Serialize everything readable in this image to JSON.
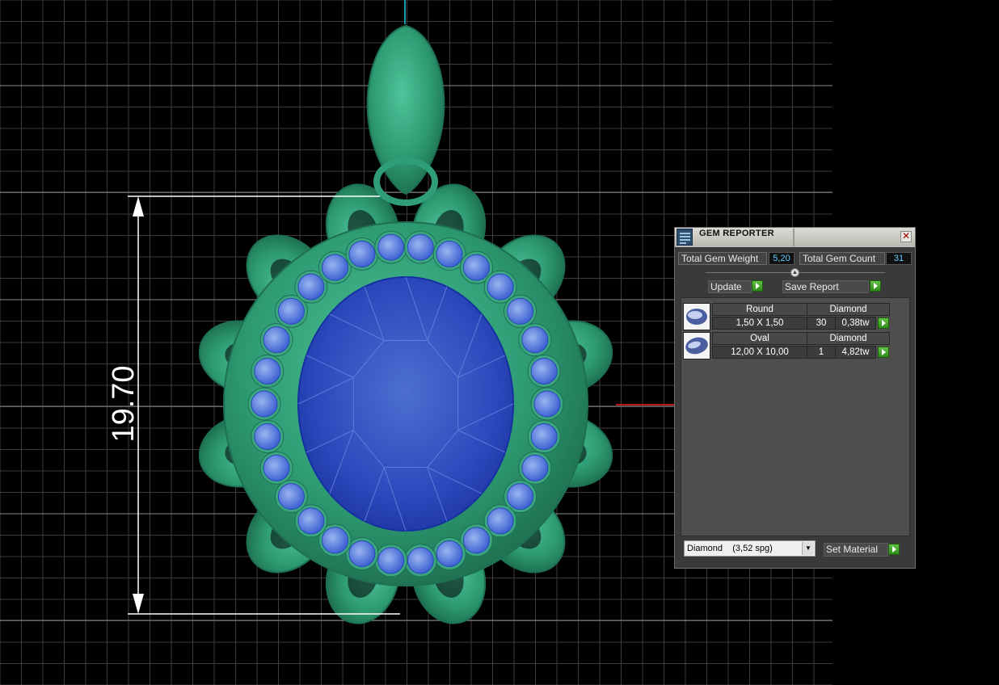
{
  "viewport": {
    "dimension_label": "19.70",
    "colors": {
      "background": "#000000",
      "grid": "#4a4a4a",
      "model": "#2f9e78",
      "center_stone": "#2a48b8",
      "accent_stones": "#5a7fe0",
      "dimension": "#ffffff",
      "axis_x": "#c01818",
      "axis_y": "#16a0b0"
    }
  },
  "panel": {
    "title": "GEM REPORTER",
    "title_icon": "gem-reporter-app-icon",
    "close_icon": "close-icon",
    "close_glyph": "✕",
    "total_weight_label": "Total Gem Weight",
    "total_weight_value": "5,20",
    "total_count_label": "Total Gem Count",
    "total_count_value": "31",
    "collapse_icon": "collapse-arrow-icon",
    "collapse_glyph": "▲",
    "update_label": "Update",
    "save_report_label": "Save Report",
    "gems": [
      {
        "shape": "Round",
        "size": "1,50 X 1,50",
        "material": "Diamond",
        "count": "30",
        "weight": "0,38tw",
        "icon": "round-gem-icon"
      },
      {
        "shape": "Oval",
        "size": "12,00 X 10,00",
        "material": "Diamond",
        "count": "1",
        "weight": "4,82tw",
        "icon": "oval-gem-icon"
      }
    ],
    "material_select": "Diamond    (3,52 spg)",
    "dropdown_glyph": "▼",
    "set_material_label": "Set Material"
  }
}
